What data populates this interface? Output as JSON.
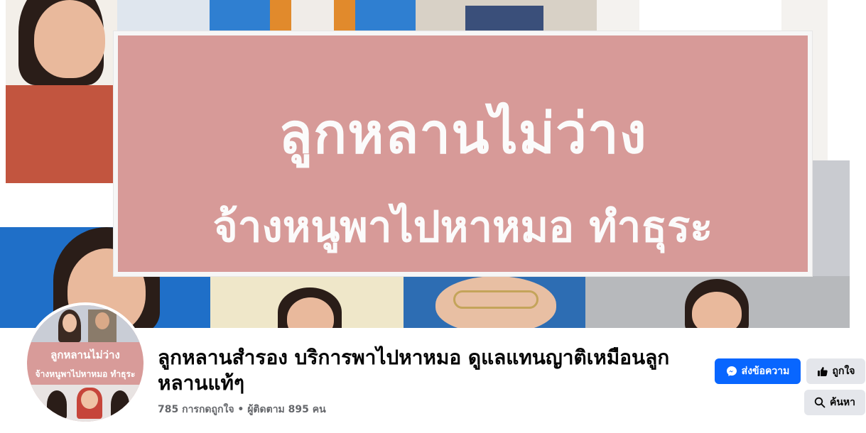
{
  "cover": {
    "banner_line1": "ลูกหลานไม่ว่าง",
    "banner_line2": "จ้างหนูพาไปหาหมอ ทำธุระ",
    "banner_color": "#d79a98"
  },
  "avatar": {
    "line1": "ลูกหลานไม่ว่าง",
    "line2": "จ้างหนูพาไปหาหมอ ทำธุระ"
  },
  "page": {
    "name": "ลูกหลานสำรอง บริการพาไปหาหมอ ดูแลแทนญาติเหมือนลูกหลานแท้ๆ",
    "stats": "785 การกดถูกใจ • ผู้ติดตาม 895 คน"
  },
  "actions": {
    "message_label": "ส่งข้อความ",
    "like_label": "ถูกใจ",
    "search_label": "ค้นหา",
    "message_icon": "messenger-icon",
    "like_icon": "thumbs-up-icon",
    "search_icon": "search-icon",
    "accent_color": "#0866ff"
  }
}
